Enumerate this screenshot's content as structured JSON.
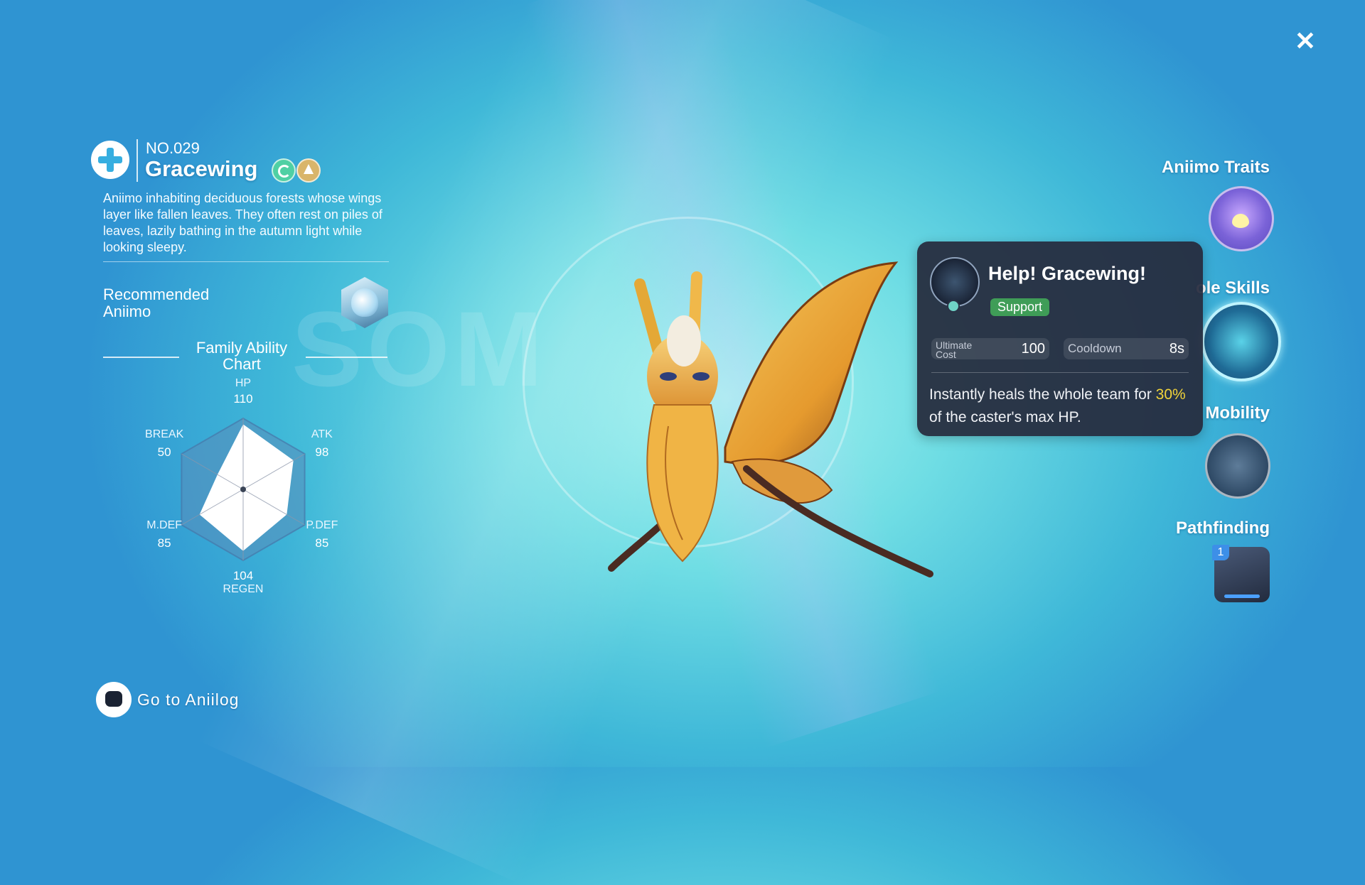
{
  "header": {
    "close_label": "✕"
  },
  "watermark": "SOM",
  "aniimo": {
    "number": "NO.029",
    "name": "Gracewing",
    "elements": [
      "wind-element-icon",
      "earth-element-icon"
    ],
    "description": "Aniimo inhabiting deciduous forests whose wings layer like fallen leaves. They often rest on piles of leaves, lazily bathing in the autumn light while looking sleepy.",
    "recommended_label": "Recommended Aniimo"
  },
  "family_chart": {
    "title": "Family Ability Chart",
    "stats": [
      {
        "label": "HP",
        "value": 110
      },
      {
        "label": "ATK",
        "value": 98
      },
      {
        "label": "P.DEF",
        "value": 85
      },
      {
        "label": "REGEN",
        "value": 104
      },
      {
        "label": "M.DEF",
        "value": 85
      },
      {
        "label": "BREAK",
        "value": 50
      }
    ],
    "max": 120
  },
  "goto_label": "Go to Aniilog",
  "right_panel": {
    "traits_label": "Aniimo Traits",
    "skills_label": "ole Skills",
    "mobility_label": "Mobility",
    "pathfinding_label": "Pathfinding",
    "pathfinding_badge": "1"
  },
  "tooltip": {
    "title": "Help! Gracewing!",
    "tag": "Support",
    "tag_color": "#3f9d57",
    "cost_label": "Ultimate Cost",
    "cost_value": "100",
    "cooldown_label": "Cooldown",
    "cooldown_value": "8s",
    "desc_pre": "Instantly heals the whole team for ",
    "desc_highlight": "30%",
    "desc_post": " of the caster's max HP.",
    "highlight_color": "#f2d43a"
  }
}
